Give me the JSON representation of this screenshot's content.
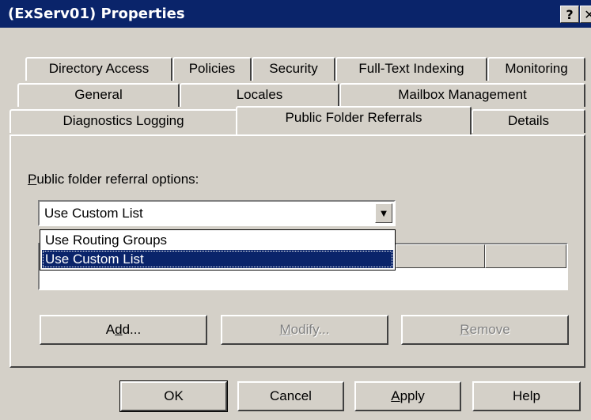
{
  "window": {
    "title": "(ExServ01) Properties",
    "help_glyph": "?",
    "close_glyph": "✕"
  },
  "tabs": {
    "row1": [
      "Directory Access",
      "Policies",
      "Security",
      "Full-Text Indexing",
      "Monitoring"
    ],
    "row2": [
      "General",
      "Locales",
      "Mailbox Management"
    ],
    "row3": [
      "Diagnostics Logging",
      "Public Folder Referrals",
      "Details"
    ],
    "active": "Public Folder Referrals"
  },
  "referral": {
    "label_first": "P",
    "label_rest": "ublic folder referral options:",
    "selected_value": "Use Custom List",
    "options": [
      "Use Routing Groups",
      "Use Custom List"
    ]
  },
  "list_buttons": {
    "add_pre": "A",
    "add_u": "d",
    "add_post": "d...",
    "modify_pre": "",
    "modify_u": "M",
    "modify_post": "odify...",
    "remove_pre": "",
    "remove_u": "R",
    "remove_post": "emove"
  },
  "dialog_buttons": {
    "ok": "OK",
    "cancel": "Cancel",
    "apply_u": "A",
    "apply_post": "pply",
    "help": "Help"
  },
  "icons": {
    "combo_arrow": "dropdown-arrow-icon"
  }
}
